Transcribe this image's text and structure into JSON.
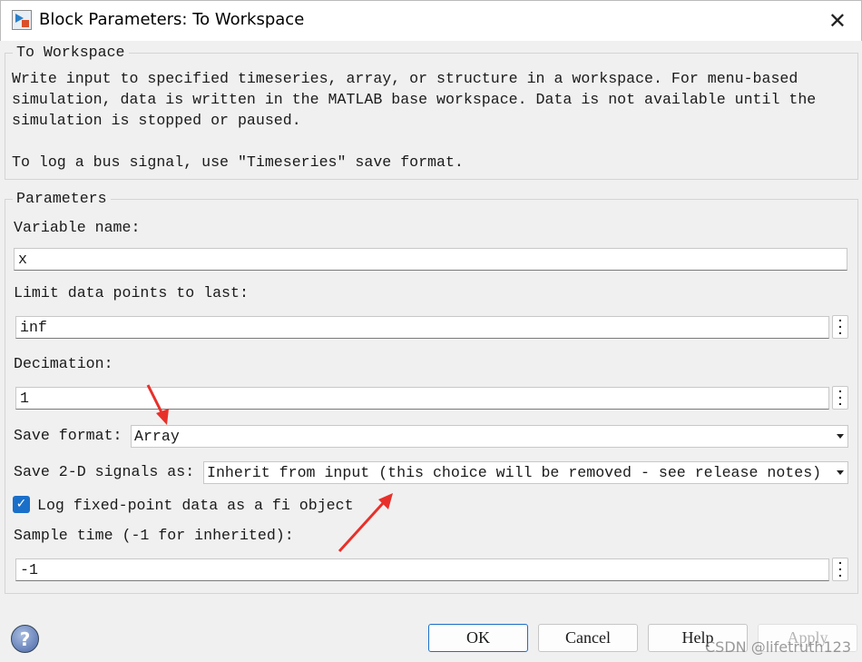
{
  "window": {
    "title": "Block Parameters: To Workspace",
    "icon": "simulink-block-icon",
    "close_icon": "close-icon"
  },
  "description": {
    "legend": "To Workspace",
    "lines": [
      "Write input to specified timeseries, array, or structure in a workspace. For menu-based",
      "simulation, data is written in the MATLAB base workspace. Data is not available until the",
      "simulation is stopped or paused.",
      "",
      "To log a bus signal, use \"Timeseries\" save format."
    ]
  },
  "parameters": {
    "legend": "Parameters",
    "variable_name": {
      "label": "Variable name:",
      "value": "x"
    },
    "limit": {
      "label": "Limit data points to last:",
      "value": "inf"
    },
    "decimation": {
      "label": "Decimation:",
      "value": "1"
    },
    "save_format": {
      "label": "Save format:",
      "value": "Array"
    },
    "save_2d": {
      "label": "Save 2-D signals as:",
      "value": "Inherit from input (this choice will be removed - see release notes)"
    },
    "log_fixed_point": {
      "label": "Log fixed-point data as a fi object",
      "checked": true
    },
    "sample_time": {
      "label": "Sample time (-1 for inherited):",
      "value": "-1"
    }
  },
  "buttons": {
    "ok": "OK",
    "cancel": "Cancel",
    "help": "Help",
    "apply": "Apply"
  },
  "annotation_color": "#e8302a",
  "watermark": "CSDN @lifetruth123"
}
